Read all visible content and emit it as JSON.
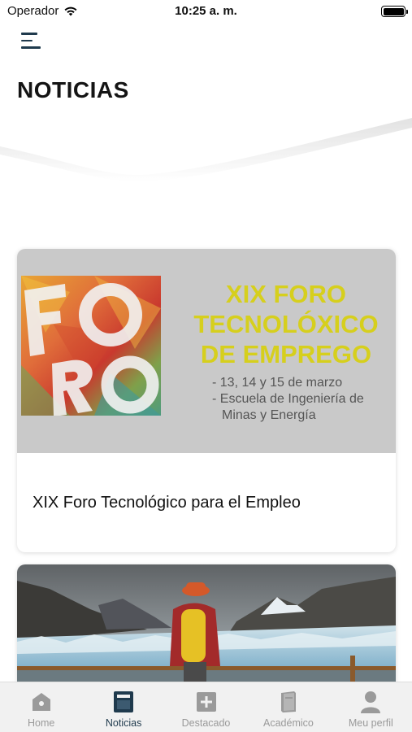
{
  "status_bar": {
    "carrier": "Operador",
    "time": "10:25 a. m."
  },
  "header": {
    "title": "NOTICIAS"
  },
  "news": [
    {
      "image": {
        "logo_text": "FORO",
        "headline_lines": [
          "XIX FORO",
          "TECNOLÓXICO",
          "DE EMPREGO"
        ],
        "detail_lines": [
          "- 13, 14 y 15 de marzo",
          "- Escuela de Ingeniería de",
          "Minas y Energía"
        ]
      },
      "title": "XIX Foro Tecnológico para el Empleo"
    },
    {
      "image": {
        "description": "glacier-photo"
      },
      "title": ""
    }
  ],
  "tabbar": {
    "tabs": [
      {
        "label": "Home",
        "icon": "home-icon",
        "active": false
      },
      {
        "label": "Noticias",
        "icon": "news-icon",
        "active": true
      },
      {
        "label": "Destacado",
        "icon": "plus-icon",
        "active": false
      },
      {
        "label": "Académico",
        "icon": "book-icon",
        "active": false
      },
      {
        "label": "Meu perfil",
        "icon": "user-icon",
        "active": false
      }
    ]
  },
  "colors": {
    "accent": "#1f3a4d",
    "inactive": "#9a9a9a",
    "foro_yellow": "#d6cf1d",
    "tabbar_bg": "#f1f1f1"
  }
}
